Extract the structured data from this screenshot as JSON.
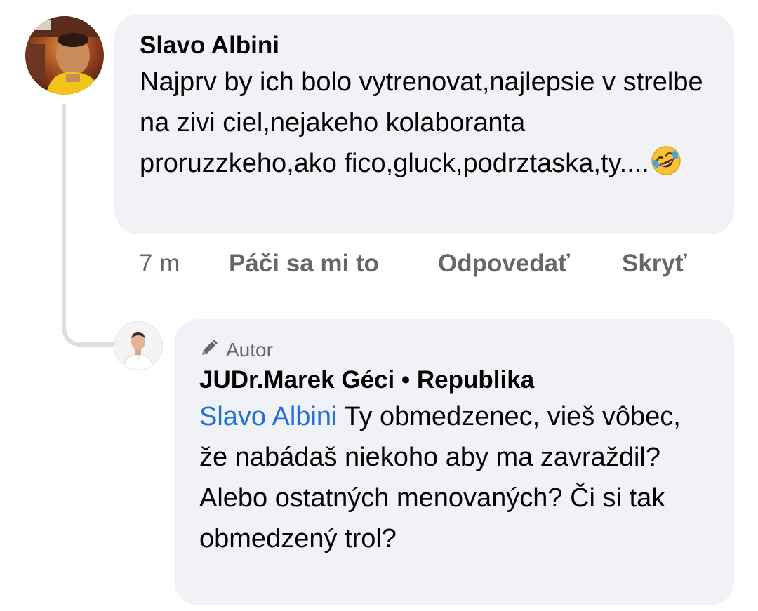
{
  "comment": {
    "author": "Slavo Albini",
    "text": "Najprv by ich bolo vytrenovat,najlepsie v strelbe na zivi ciel,nejakeho kolaboranta proruzzkeho,ako fico,gluck,podrztaska,ty....",
    "emoji_icon": "rolling-on-floor-laughing-emoji",
    "actions": {
      "time": "7 m",
      "like": "Páči sa mi to",
      "reply": "Odpovedať",
      "hide": "Skryť"
    }
  },
  "reply": {
    "badge": "Autor",
    "badge_icon": "pencil-icon",
    "author": "JUDr.Marek Géci • Republika",
    "mention": "Slavo Albini",
    "text": " Ty obmedzenec, vieš vôbec, že nabádaš niekoho aby ma zavraždil? Alebo ostatných menovaných? Či si tak obmedzený trol?"
  },
  "colors": {
    "bubble": "#f0f2f5",
    "mention": "#216fdb",
    "secondary_text": "#65676b",
    "thread_line": "#dcdee3"
  }
}
